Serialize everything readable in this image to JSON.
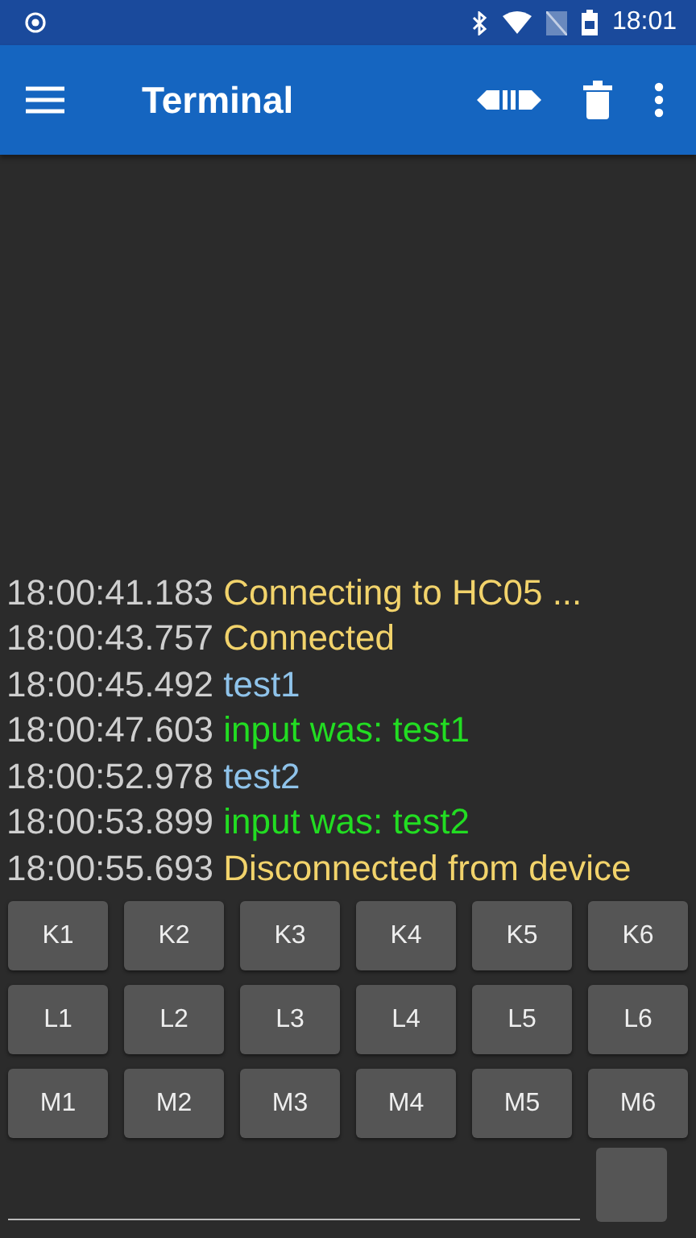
{
  "status_bar": {
    "time": "18:01"
  },
  "toolbar": {
    "title": "Terminal"
  },
  "log": [
    {
      "time": "18:00:41.183",
      "text": "Connecting to HC05 ...",
      "kind": "status"
    },
    {
      "time": "18:00:43.757",
      "text": "Connected",
      "kind": "status"
    },
    {
      "time": "18:00:45.492",
      "text": "test1",
      "kind": "sent"
    },
    {
      "time": "18:00:47.603",
      "text": "input was: test1",
      "kind": "received"
    },
    {
      "time": "18:00:52.978",
      "text": "test2",
      "kind": "sent"
    },
    {
      "time": "18:00:53.899",
      "text": "input was: test2",
      "kind": "received"
    },
    {
      "time": "18:00:55.693",
      "text": "Disconnected from device",
      "kind": "status"
    }
  ],
  "macro_buttons": [
    [
      "K1",
      "K2",
      "K3",
      "K4",
      "K5",
      "K6"
    ],
    [
      "L1",
      "L2",
      "L3",
      "L4",
      "L5",
      "L6"
    ],
    [
      "M1",
      "M2",
      "M3",
      "M4",
      "M5",
      "M6"
    ]
  ]
}
